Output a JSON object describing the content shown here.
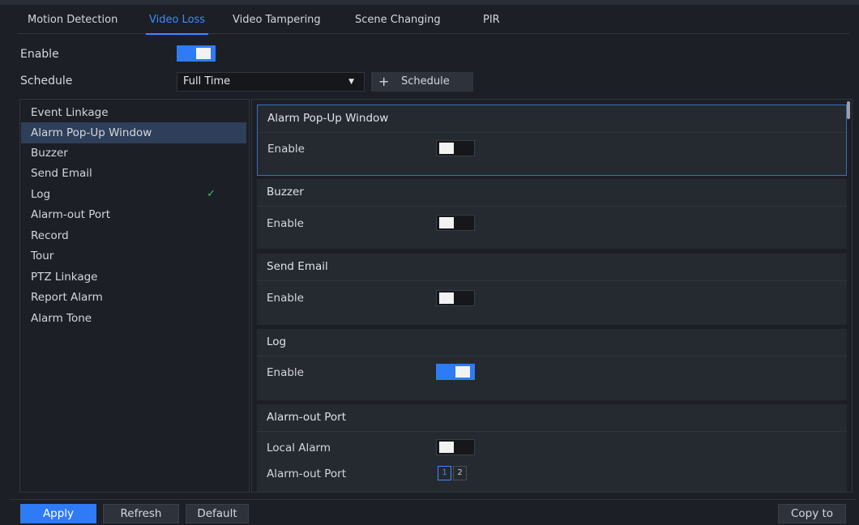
{
  "tabs": [
    "Motion Detection",
    "Video Loss",
    "Video Tampering",
    "Scene Changing",
    "PIR"
  ],
  "active_tab": "Video Loss",
  "enable": {
    "label": "Enable",
    "on": true
  },
  "schedule": {
    "label": "Schedule",
    "value": "Full Time",
    "add_button_plus": "+",
    "add_button_label": "Schedule"
  },
  "linkage_list": {
    "items": [
      "Event Linkage",
      "Alarm Pop-Up Window",
      "Buzzer",
      "Send Email",
      "Log",
      "Alarm-out Port",
      "Record",
      "Tour",
      "PTZ Linkage",
      "Report Alarm",
      "Alarm Tone"
    ],
    "selected": "Alarm Pop-Up Window",
    "checked": [
      "Log"
    ],
    "check_glyph": "✓"
  },
  "sections": {
    "alarm_popup": {
      "title": "Alarm Pop-Up Window",
      "enable_label": "Enable",
      "on": false
    },
    "buzzer": {
      "title": "Buzzer",
      "enable_label": "Enable",
      "on": false
    },
    "send_email": {
      "title": "Send Email",
      "enable_label": "Enable",
      "on": false
    },
    "log": {
      "title": "Log",
      "enable_label": "Enable",
      "on": true
    },
    "alarm_out": {
      "title": "Alarm-out Port",
      "local_alarm_label": "Local Alarm",
      "local_alarm_on": false,
      "port_label": "Alarm-out Port",
      "ports": [
        "1",
        "2"
      ],
      "selected_port": "1"
    }
  },
  "buttons": {
    "apply": "Apply",
    "refresh": "Refresh",
    "default": "Default",
    "copy_to": "Copy to"
  },
  "colors": {
    "accent": "#2f7bf5",
    "check": "#43c36a",
    "background": "#1c1f25",
    "panel": "#252930"
  }
}
